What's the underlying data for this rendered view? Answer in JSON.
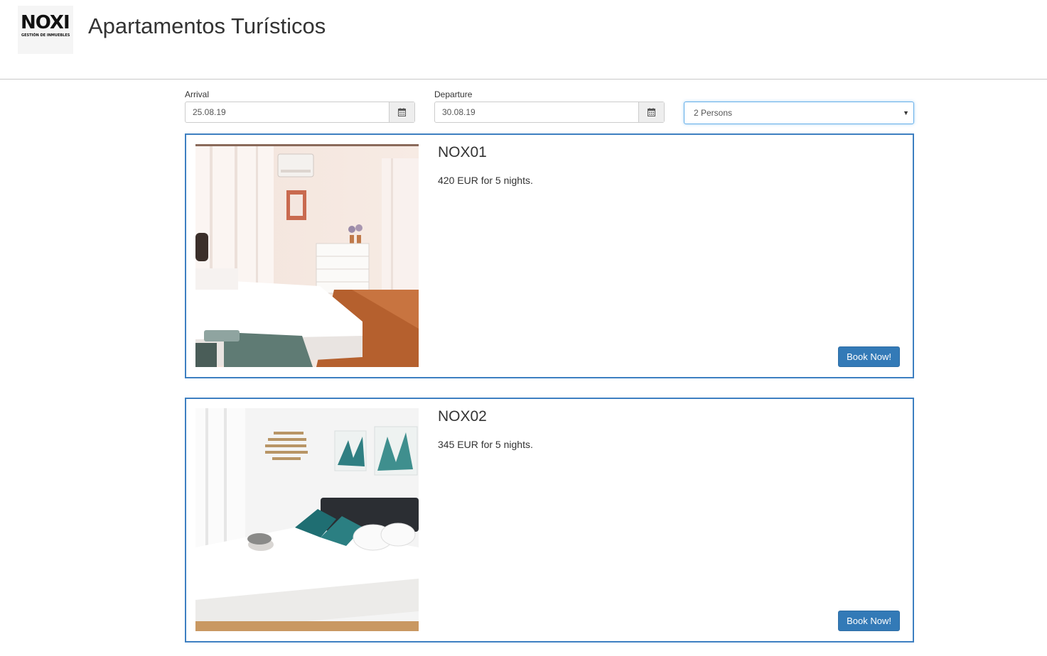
{
  "header": {
    "logo_text": "NOXI",
    "logo_subtext": "GESTIÓN DE INMUEBLES",
    "title": "Apartamentos Turísticos"
  },
  "search": {
    "arrival_label": "Arrival",
    "arrival_value": "25.08.19",
    "departure_label": "Departure",
    "departure_value": "30.08.19",
    "persons_value": "2 Persons",
    "calendar_icon": "calendar-icon",
    "dropdown_icon": "caret-down-icon"
  },
  "listings": [
    {
      "name": "NOX01",
      "price_text": "420 EUR for 5 nights.",
      "button_label": "Book Now!"
    },
    {
      "name": "NOX02",
      "price_text": "345 EUR for 5 nights.",
      "button_label": "Book Now!"
    }
  ],
  "colors": {
    "accent": "#337ab7",
    "card_border": "#3d7fc1",
    "text": "#333333"
  }
}
